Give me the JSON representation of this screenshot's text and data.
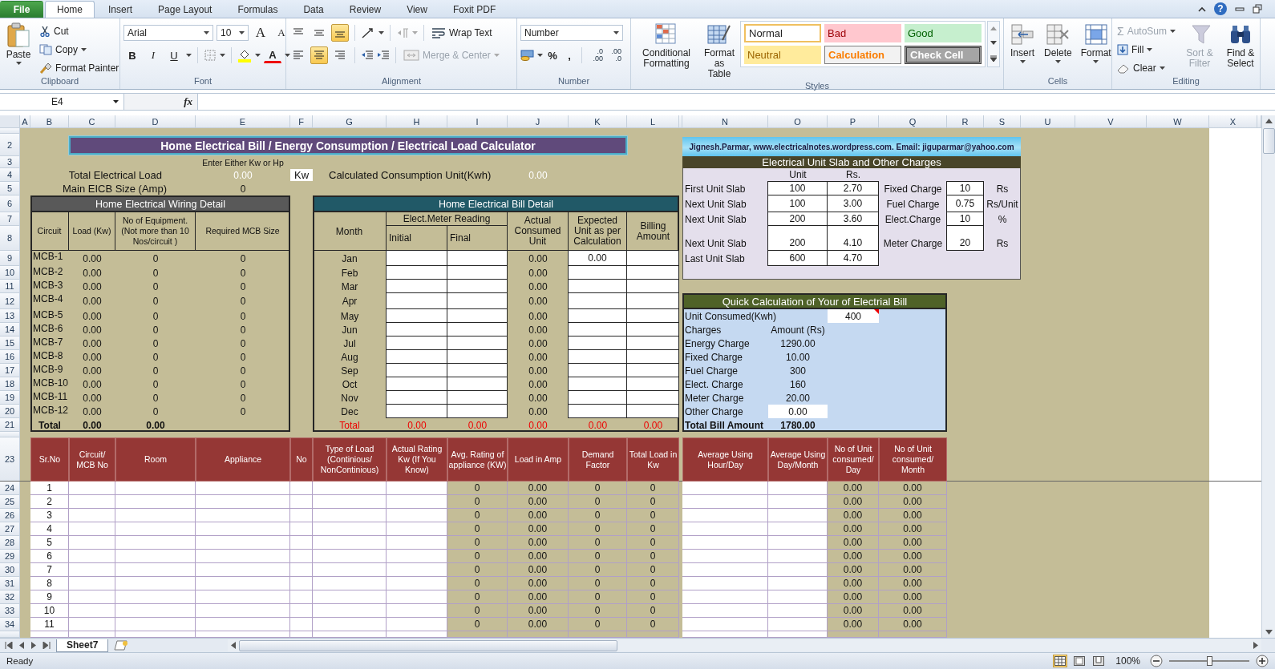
{
  "tabs": [
    {
      "label": "File",
      "kind": "file",
      "selected": false
    },
    {
      "label": "Home",
      "kind": "tab",
      "selected": true
    },
    {
      "label": "Insert",
      "kind": "tab",
      "selected": false
    },
    {
      "label": "Page Layout",
      "kind": "tab",
      "selected": false
    },
    {
      "label": "Formulas",
      "kind": "tab",
      "selected": false
    },
    {
      "label": "Data",
      "kind": "tab",
      "selected": false
    },
    {
      "label": "Review",
      "kind": "tab",
      "selected": false
    },
    {
      "label": "View",
      "kind": "tab",
      "selected": false
    },
    {
      "label": "Foxit PDF",
      "kind": "tab",
      "selected": false
    }
  ],
  "help": "?",
  "ribbon": {
    "clipboard": {
      "label": "Clipboard",
      "paste": "Paste",
      "cut": "Cut",
      "copy": "Copy",
      "format_painter": "Format Painter"
    },
    "font": {
      "label": "Font",
      "name": "Arial",
      "size": "10",
      "grow": "A",
      "shrink": "A",
      "bold": "B",
      "italic": "I",
      "underline": "U",
      "color_button": "A"
    },
    "alignment": {
      "label": "Alignment",
      "vertical": [
        {
          "selected": false
        },
        {
          "selected": false
        },
        {
          "selected": true
        }
      ],
      "horizontal": [
        {
          "selected": false
        },
        {
          "selected": true
        },
        {
          "selected": false
        }
      ],
      "buttons": [
        {
          "label": "Wrap Text",
          "kind": "wrap",
          "disabled": false
        },
        {
          "label": "Merge & Center",
          "kind": "merge",
          "disabled": true
        }
      ]
    },
    "number": {
      "label": "Number",
      "format": "Number",
      "percent": "%",
      "comma": ",",
      "decimals": [
        {
          "top": ".0",
          "bottom": ".00"
        },
        {
          "top": ".00",
          "bottom": ".0"
        }
      ]
    },
    "styles": {
      "label": "Styles",
      "conditional_formatting": "Conditional Formatting",
      "format_as_table": "Format as Table",
      "cell_styles": [
        {
          "label": "Normal",
          "kind": "normal"
        },
        {
          "label": "Bad",
          "kind": "bad"
        },
        {
          "label": "Good",
          "kind": "good"
        },
        {
          "label": "Neutral",
          "kind": "neutral"
        },
        {
          "label": "Calculation",
          "kind": "calculation"
        },
        {
          "label": "Check Cell",
          "kind": "check"
        }
      ]
    },
    "cells": {
      "label": "Cells",
      "buttons": [
        {
          "label": "Insert",
          "kind": "insert"
        },
        {
          "label": "Delete",
          "kind": "delete"
        },
        {
          "label": "Format",
          "kind": "format"
        }
      ]
    },
    "editing": {
      "label": "Editing",
      "items": [
        {
          "kind": "autosum",
          "symbol": "Σ",
          "label": "AutoSum",
          "disabled": true
        },
        {
          "kind": "fill",
          "label": "Fill",
          "disabled": false
        },
        {
          "kind": "clear",
          "label": "Clear",
          "disabled": false
        },
        {
          "kind": "sort",
          "label": "Sort & Filter",
          "disabled": true
        },
        {
          "kind": "find",
          "label": "Find & Select",
          "disabled": false
        }
      ]
    }
  },
  "name_box": "E4",
  "fx": "fx",
  "column_headers": [
    "A",
    "B",
    "C",
    "D",
    "E",
    "F",
    "G",
    "H",
    "I",
    "J",
    "K",
    "L",
    "N",
    "O",
    "P",
    "Q",
    "R",
    "S",
    "U",
    "V",
    "W",
    "X"
  ],
  "row_headers": [
    "2",
    "3",
    "4",
    "5",
    "6",
    "7",
    "8",
    "9",
    "10",
    "11",
    "12",
    "13",
    "14",
    "15",
    "16",
    "17",
    "18",
    "19",
    "20",
    "21"
  ],
  "lower_row_headers": [
    "23",
    "24",
    "25",
    "26",
    "27",
    "28",
    "29",
    "30",
    "31",
    "32",
    "33",
    "34"
  ],
  "sheet": {
    "title": "Home Electrical Bill / Energy Consumption / Electrical Load Calculator",
    "hint": "Enter Either Kw or Hp",
    "total_load": {
      "label": "Total Electrical Load",
      "value": "0.00",
      "unit": "Kw"
    },
    "consumption": {
      "label": "Calculated Consumption Unit(Kwh)",
      "value": "0.00"
    },
    "main_eicb": {
      "label": "Main EICB Size (Amp)",
      "value": "0"
    },
    "wiring": {
      "title": "Home Electrical Wiring Detail",
      "columns": [
        "Circuit",
        "Load (Kw)",
        "No of Equipment. (Not more than 10 Nos/circuit )",
        "Required MCB Size"
      ],
      "rows": [
        [
          "MCB-1",
          "0.00",
          "0",
          "0"
        ],
        [
          "MCB-2",
          "0.00",
          "0",
          "0"
        ],
        [
          "MCB-3",
          "0.00",
          "0",
          "0"
        ],
        [
          "MCB-4",
          "0.00",
          "0",
          "0"
        ],
        [
          "MCB-5",
          "0.00",
          "0",
          "0"
        ],
        [
          "MCB-6",
          "0.00",
          "0",
          "0"
        ],
        [
          "MCB-7",
          "0.00",
          "0",
          "0"
        ],
        [
          "MCB-8",
          "0.00",
          "0",
          "0"
        ],
        [
          "MCB-9",
          "0.00",
          "0",
          "0"
        ],
        [
          "MCB-10",
          "0.00",
          "0",
          "0"
        ],
        [
          "MCB-11",
          "0.00",
          "0",
          "0"
        ],
        [
          "MCB-12",
          "0.00",
          "0",
          "0"
        ]
      ],
      "total": [
        "Total",
        "0.00",
        "0.00"
      ]
    },
    "bill": {
      "title": "Home Electrical Bill Detail",
      "month_label": "Month",
      "meter_label": "Elect.Meter Reading",
      "initial_label": "Initial",
      "final_label": "Final",
      "actual_label": "Actual Consumed Unit",
      "expected_label": "Expected Unit as per Calculation",
      "billing_label": "Billing Amount",
      "rows": [
        {
          "month": "Jan",
          "actual": "0.00",
          "expected": "0.00"
        },
        {
          "month": "Feb",
          "actual": "0.00"
        },
        {
          "month": "Mar",
          "actual": "0.00"
        },
        {
          "month": "Apr",
          "actual": "0.00"
        },
        {
          "month": "May",
          "actual": "0.00"
        },
        {
          "month": "Jun",
          "actual": "0.00"
        },
        {
          "month": "Jul",
          "actual": "0.00"
        },
        {
          "month": "Aug",
          "actual": "0.00"
        },
        {
          "month": "Sep",
          "actual": "0.00"
        },
        {
          "month": "Oct",
          "actual": "0.00"
        },
        {
          "month": "Nov",
          "actual": "0.00"
        },
        {
          "month": "Dec",
          "actual": "0.00"
        }
      ],
      "total": {
        "label": "Total",
        "values": [
          "0.00",
          "0.00",
          "0.00",
          "0.00",
          "0.00"
        ]
      }
    },
    "credit": "Jignesh.Parmar, www.electricalnotes.wordpress.com. Email: jiguparmar@yahoo.com",
    "slabs": {
      "title": "Electrical Unit Slab and Other Charges",
      "unit_label": "Unit",
      "rate_label": "Rs.",
      "rows": [
        {
          "label": "First Unit Slab",
          "unit": "100",
          "rate": "2.70"
        },
        {
          "label": "Next Unit Slab",
          "unit": "100",
          "rate": "3.00"
        },
        {
          "label": "Next Unit Slab",
          "unit": "200",
          "rate": "3.60"
        },
        {
          "label": "Next Unit Slab",
          "unit": "200",
          "rate": "4.10"
        },
        {
          "label": "Last Unit Slab",
          "unit": "600",
          "rate": "4.70"
        }
      ],
      "charges": [
        {
          "label": "Fixed Charge",
          "value": "10",
          "unit": "Rs"
        },
        {
          "label": "Fuel Charge",
          "value": "0.75",
          "unit": "Rs/Unit"
        },
        {
          "label": "Elect.Charge",
          "value": "10",
          "unit": "%"
        },
        {
          "label": "Meter Charge",
          "value": "20",
          "unit": "Rs"
        }
      ]
    },
    "quick": {
      "title": "Quick Calculation of Your of Electrial Bill",
      "unit_label": "Unit Consumed(Kwh)",
      "unit_value": "400",
      "charges_label": "Charges",
      "amount_label": "Amount (Rs)",
      "items": [
        {
          "label": "Energy Charge",
          "value": "1290.00",
          "kind": "calc"
        },
        {
          "label": "Fixed Charge",
          "value": "10.00",
          "kind": "calc"
        },
        {
          "label": "Fuel Charge",
          "value": "300",
          "kind": "calc"
        },
        {
          "label": "Elect. Charge",
          "value": "160",
          "kind": "calc"
        },
        {
          "label": "Meter Charge",
          "value": "20.00",
          "kind": "calc"
        },
        {
          "label": "Other Charge",
          "value": "0.00",
          "kind": "input"
        }
      ],
      "total": {
        "label": "Total Bill Amount",
        "value": "1780.00"
      }
    },
    "load_table": {
      "columns": [
        "Sr.No",
        "Circuit/ MCB No",
        "Room",
        "Appliance",
        "No",
        "Type of Load (Continious/ NonContinious)",
        "Actual Rating Kw (If You Know)",
        "Avg. Rating of appliance (KW)",
        "Load in Amp",
        "Demand Factor",
        "Total Load in Kw",
        "Average Using Hour/Day",
        "Average Using Day/Month",
        "No of Unit consumed/ Day",
        "No of Unit consumed/ Month"
      ],
      "rows": [
        {
          "sr": "1",
          "avg": "0",
          "amp": "0.00",
          "demand": "0",
          "total": "0",
          "day": "0.00",
          "month": "0.00"
        },
        {
          "sr": "2",
          "avg": "0",
          "amp": "0.00",
          "demand": "0",
          "total": "0",
          "day": "0.00",
          "month": "0.00"
        },
        {
          "sr": "3",
          "avg": "0",
          "amp": "0.00",
          "demand": "0",
          "total": "0",
          "day": "0.00",
          "month": "0.00"
        },
        {
          "sr": "4",
          "avg": "0",
          "amp": "0.00",
          "demand": "0",
          "total": "0",
          "day": "0.00",
          "month": "0.00"
        },
        {
          "sr": "5",
          "avg": "0",
          "amp": "0.00",
          "demand": "0",
          "total": "0",
          "day": "0.00",
          "month": "0.00"
        },
        {
          "sr": "6",
          "avg": "0",
          "amp": "0.00",
          "demand": "0",
          "total": "0",
          "day": "0.00",
          "month": "0.00"
        },
        {
          "sr": "7",
          "avg": "0",
          "amp": "0.00",
          "demand": "0",
          "total": "0",
          "day": "0.00",
          "month": "0.00"
        },
        {
          "sr": "8",
          "avg": "0",
          "amp": "0.00",
          "demand": "0",
          "total": "0",
          "day": "0.00",
          "month": "0.00"
        },
        {
          "sr": "9",
          "avg": "0",
          "amp": "0.00",
          "demand": "0",
          "total": "0",
          "day": "0.00",
          "month": "0.00"
        },
        {
          "sr": "10",
          "avg": "0",
          "amp": "0.00",
          "demand": "0",
          "total": "0",
          "day": "0.00",
          "month": "0.00"
        },
        {
          "sr": "11",
          "avg": "0",
          "amp": "0.00",
          "demand": "0",
          "total": "0",
          "day": "0.00",
          "month": "0.00"
        }
      ]
    }
  },
  "sheet_tabs": [
    {
      "label": "Sheet7",
      "selected": true
    }
  ],
  "status_bar": {
    "status": "Ready",
    "views": [
      {
        "selected": true
      },
      {
        "selected": false
      },
      {
        "selected": false
      }
    ],
    "zoom": "100%",
    "zoom_slider": {
      "level": 0.5
    }
  }
}
